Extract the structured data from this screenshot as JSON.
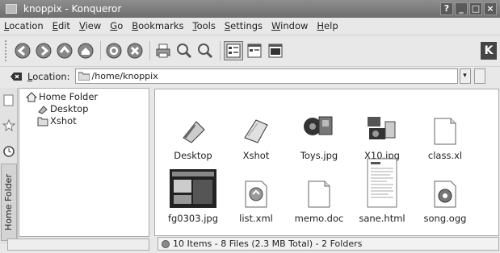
{
  "window": {
    "title": "knoppix - Konqueror",
    "buttons": [
      "?",
      "_",
      "□",
      "×"
    ]
  },
  "menubar": [
    {
      "label": "Location",
      "key": "L",
      "rest": "ocation"
    },
    {
      "label": "Edit",
      "key": "E",
      "rest": "dit"
    },
    {
      "label": "View",
      "key": "V",
      "rest": "iew"
    },
    {
      "label": "Go",
      "key": "G",
      "rest": "o"
    },
    {
      "label": "Bookmarks",
      "key": "B",
      "rest": "ookmarks"
    },
    {
      "label": "Tools",
      "key": "T",
      "rest": "ools"
    },
    {
      "label": "Settings",
      "key": "S",
      "rest": "ettings"
    },
    {
      "label": "Window",
      "key": "W",
      "rest": "indow"
    },
    {
      "label": "Help",
      "key": "H",
      "rest": "elp"
    }
  ],
  "toolbar": {
    "icons": [
      "back-icon",
      "forward-icon",
      "up-icon",
      "home-icon",
      "reload-icon",
      "stop-icon",
      "print-icon",
      "zoom-in-icon",
      "zoom-out-icon",
      "icon-view-icon",
      "detail-view-icon",
      "multi-view-icon"
    ],
    "kde_logo": "K"
  },
  "location": {
    "label_key": "L",
    "label_rest": "ocation:",
    "value": "/home/knoppix"
  },
  "sidebar": {
    "tab_label": "Home Folder"
  },
  "tree": [
    {
      "label": "Home Folder",
      "icon": "home-icon"
    },
    {
      "label": "Desktop",
      "icon": "desktop-icon"
    },
    {
      "label": "Xshot",
      "icon": "folder-icon"
    }
  ],
  "files": [
    {
      "name": "Desktop",
      "icon": "desktop-folder-icon"
    },
    {
      "name": "Xshot",
      "icon": "folder-icon"
    },
    {
      "name": "Toys.jpg",
      "icon": "image-icon"
    },
    {
      "name": "X10.jpg",
      "icon": "image-icon"
    },
    {
      "name": "class.xl",
      "icon": "document-icon"
    },
    {
      "name": "fg0303.jpg",
      "icon": "image-icon"
    },
    {
      "name": "list.xml",
      "icon": "xml-icon"
    },
    {
      "name": "memo.doc",
      "icon": "document-icon"
    },
    {
      "name": "sane.html",
      "icon": "html-icon"
    },
    {
      "name": "song.ogg",
      "icon": "audio-icon"
    }
  ],
  "status": {
    "text": "10 Items - 8 Files (2.3 MB Total) - 2 Folders"
  }
}
